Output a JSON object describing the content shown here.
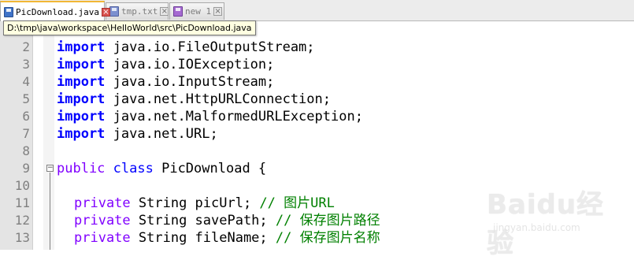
{
  "tabs": [
    {
      "label": "PicDownload.java",
      "state": "active",
      "icon": "saved-file-icon"
    },
    {
      "label": "tmp.txt",
      "state": "inactive",
      "icon": "file-icon"
    },
    {
      "label": "new 1",
      "state": "inactive",
      "icon": "unsaved-file-icon"
    }
  ],
  "tooltip": {
    "text": "D:\\tmp\\java\\workspace\\HelloWorld\\src\\PicDownload.java"
  },
  "lines": [
    {
      "num": "2",
      "keyword": "import",
      "rest": " java.io.FileOutputStream;"
    },
    {
      "num": "3",
      "keyword": "import",
      "rest": " java.io.IOException;"
    },
    {
      "num": "4",
      "keyword": "import",
      "rest": " java.io.InputStream;"
    },
    {
      "num": "5",
      "keyword": "import",
      "rest": " java.net.HttpURLConnection;"
    },
    {
      "num": "6",
      "keyword": "import",
      "rest": " java.net.MalformedURLException;"
    },
    {
      "num": "7",
      "keyword": "import",
      "rest": " java.net.URL;"
    },
    {
      "num": "8"
    },
    {
      "num": "9",
      "modifier": "public",
      "cls_kw": "class",
      "rest": " PicDownload {"
    },
    {
      "num": "10"
    },
    {
      "num": "11",
      "modifier": "private",
      "rest": " String picUrl; ",
      "comment": "// 图片URL"
    },
    {
      "num": "12",
      "modifier": "private",
      "rest": " String savePath; ",
      "comment": "// 保存图片路径"
    },
    {
      "num": "13",
      "modifier": "private",
      "rest": " String fileName; ",
      "comment": "// 保存图片名称"
    }
  ],
  "watermark": {
    "logo": "Baidu经验",
    "sub": "jingyan.baidu.com"
  },
  "colors": {
    "keyword": "#0000ff",
    "modifier": "#8000ff",
    "comment": "#008000",
    "active_tab_accent": "#f2b735"
  }
}
